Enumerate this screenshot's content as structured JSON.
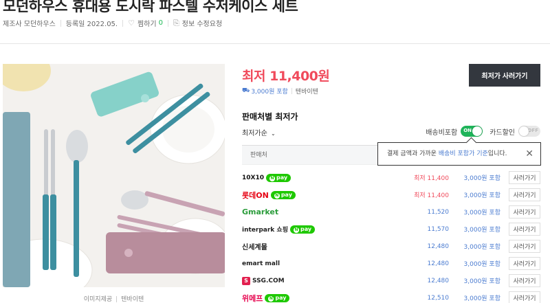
{
  "product": {
    "title": "모던하우스 휴대용 도시락 파스텔 수저케이스 세트",
    "maker": "제조사 모던하우스",
    "registered": "등록일 2022.05.",
    "wish_label": "찜하기",
    "wish_count": "0",
    "report_label": "정보 수정요청"
  },
  "image": {
    "caption_source": "이미지제공",
    "caption_vendor": "텐바이텐"
  },
  "price": {
    "lowest": "최저 11,400원",
    "shipping": "3,000원 포함",
    "vendor": "텐바이텐",
    "buy_label": "최저가 사러가기"
  },
  "sellers": {
    "title": "판매처별 최저가",
    "sort_label": "최저가순",
    "ship_include_label": "배송비포함",
    "ship_include_state": "ON",
    "card_discount_label": "카드할인",
    "card_discount_state": "OFF",
    "column_header": "판매처",
    "tooltip": {
      "before": "결제 금액과 가까운 ",
      "highlight": "배송비 포함가 기준",
      "after": "입니다."
    },
    "rows": [
      {
        "name": "10X10",
        "npay": "pay",
        "price": "최저 11,400",
        "ship": "3,000원 포함",
        "button": "사러가기"
      },
      {
        "name": "롯데ON",
        "npay": "pay",
        "price": "최저 11,400",
        "ship": "3,000원 포함",
        "button": "사러가기"
      },
      {
        "name": "Gmarket",
        "npay": "",
        "price": "11,520",
        "ship": "3,000원 포함",
        "button": "사러가기"
      },
      {
        "name": "interpark 쇼핑",
        "npay": "pay",
        "price": "11,570",
        "ship": "3,000원 포함",
        "button": "사러가기"
      },
      {
        "name": "신세계몰",
        "npay": "",
        "price": "12,480",
        "ship": "3,000원 포함",
        "button": "사러가기"
      },
      {
        "name": "emart mall",
        "npay": "",
        "price": "12,480",
        "ship": "3,000원 포함",
        "button": "사러가기"
      },
      {
        "name": "SSG.COM",
        "npay": "",
        "price": "12,480",
        "ship": "3,000원 포함",
        "button": "사러가기"
      },
      {
        "name": "위메프",
        "npay": "pay",
        "price": "12,510",
        "ship": "3,000원 포함",
        "button": "사러가기"
      }
    ]
  },
  "colors": {
    "accent_red": "#f04a5b",
    "link_blue": "#4a7bd0",
    "toggle_green": "#1fb45a",
    "npay_green": "#1ec800",
    "buy_button": "#33373e"
  }
}
